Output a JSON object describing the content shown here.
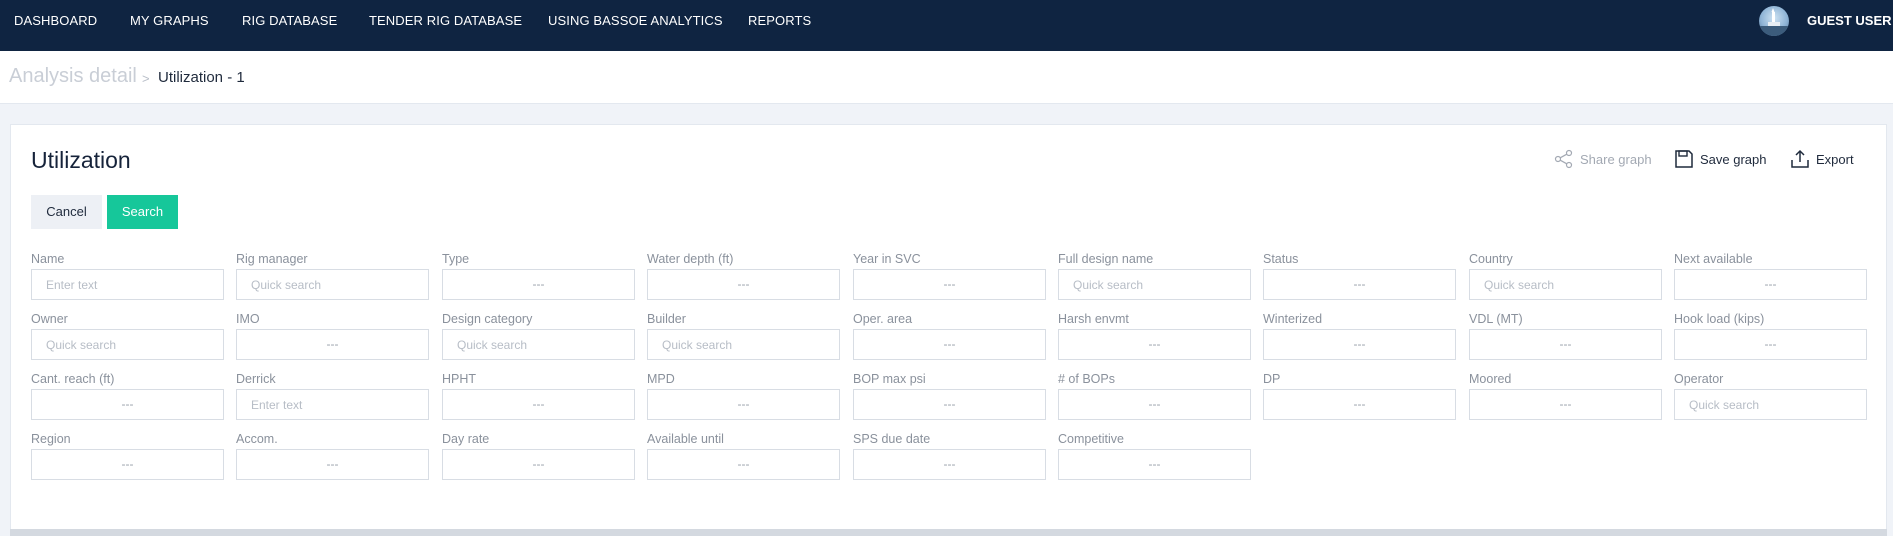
{
  "nav": {
    "items": [
      "DASHBOARD",
      "MY GRAPHS",
      "RIG DATABASE",
      "TENDER RIG DATABASE",
      "USING BASSOE ANALYTICS",
      "REPORTS"
    ],
    "user": "GUEST USER"
  },
  "breadcrumb": {
    "root": "Analysis detail",
    "separator": ">",
    "current": "Utilization - 1"
  },
  "header": {
    "title": "Utilization",
    "share_label": "Share graph",
    "save_label": "Save graph",
    "export_label": "Export"
  },
  "buttons": {
    "cancel": "Cancel",
    "search": "Search"
  },
  "filters": [
    [
      {
        "label": "Name",
        "kind": "text",
        "placeholder": "Enter text"
      },
      {
        "label": "Rig manager",
        "kind": "search",
        "placeholder": "Quick search"
      },
      {
        "label": "Type",
        "kind": "select",
        "value": "---"
      },
      {
        "label": "Water depth (ft)",
        "kind": "select",
        "value": "---"
      },
      {
        "label": "Year in SVC",
        "kind": "select",
        "value": "---"
      },
      {
        "label": "Full design name",
        "kind": "search",
        "placeholder": "Quick search"
      },
      {
        "label": "Status",
        "kind": "select",
        "value": "---"
      },
      {
        "label": "Country",
        "kind": "search",
        "placeholder": "Quick search"
      },
      {
        "label": "Next available",
        "kind": "select",
        "value": "---"
      }
    ],
    [
      {
        "label": "Owner",
        "kind": "search",
        "placeholder": "Quick search"
      },
      {
        "label": "IMO",
        "kind": "select",
        "value": "---"
      },
      {
        "label": "Design category",
        "kind": "search",
        "placeholder": "Quick search"
      },
      {
        "label": "Builder",
        "kind": "search",
        "placeholder": "Quick search"
      },
      {
        "label": "Oper. area",
        "kind": "select",
        "value": "---"
      },
      {
        "label": "Harsh envmt",
        "kind": "select",
        "value": "---"
      },
      {
        "label": "Winterized",
        "kind": "select",
        "value": "---"
      },
      {
        "label": "VDL (MT)",
        "kind": "select",
        "value": "---"
      },
      {
        "label": "Hook load (kips)",
        "kind": "select",
        "value": "---"
      }
    ],
    [
      {
        "label": "Cant. reach (ft)",
        "kind": "select",
        "value": "---"
      },
      {
        "label": "Derrick",
        "kind": "text",
        "placeholder": "Enter text"
      },
      {
        "label": "HPHT",
        "kind": "select",
        "value": "---"
      },
      {
        "label": "MPD",
        "kind": "select",
        "value": "---"
      },
      {
        "label": "BOP max psi",
        "kind": "select",
        "value": "---"
      },
      {
        "label": "# of BOPs",
        "kind": "select",
        "value": "---"
      },
      {
        "label": "DP",
        "kind": "select",
        "value": "---"
      },
      {
        "label": "Moored",
        "kind": "select",
        "value": "---"
      },
      {
        "label": "Operator",
        "kind": "search",
        "placeholder": "Quick search"
      }
    ],
    [
      {
        "label": "Region",
        "kind": "select",
        "value": "---"
      },
      {
        "label": "Accom.",
        "kind": "select",
        "value": "---"
      },
      {
        "label": "Day rate",
        "kind": "select",
        "value": "---"
      },
      {
        "label": "Available until",
        "kind": "select",
        "value": "---"
      },
      {
        "label": "SPS due date",
        "kind": "select",
        "value": "---"
      },
      {
        "label": "Competitive",
        "kind": "select",
        "value": "---"
      }
    ]
  ],
  "colors": {
    "nav_bg": "#0f2441",
    "accent": "#16c79a",
    "page_bg": "#f0f3f8"
  }
}
